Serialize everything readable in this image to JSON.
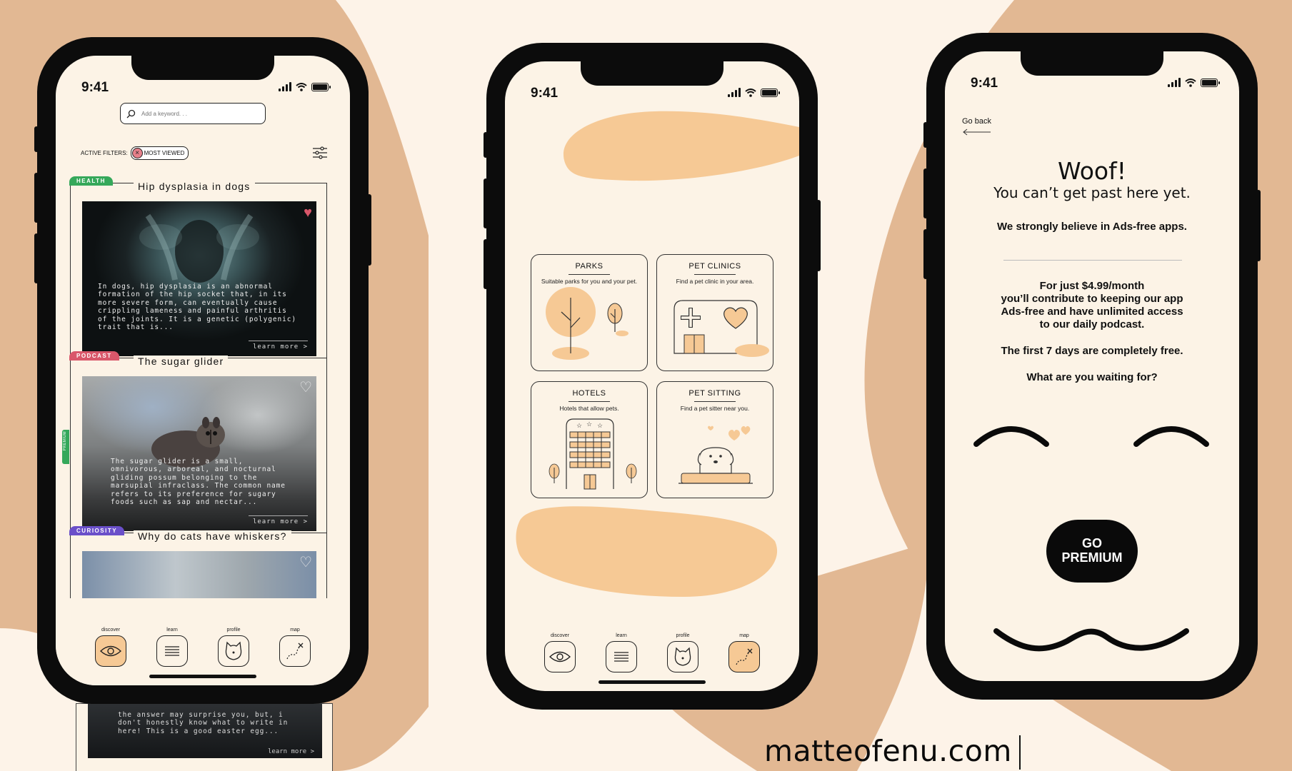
{
  "status_time": "9:41",
  "colors": {
    "background": "#fdf3e8",
    "accent_peach": "#f6c995",
    "tan_background": "#e2b893",
    "tag_health": "#35a85a",
    "tag_podcast": "#d9576a",
    "tag_curiosity": "#6a4fc9",
    "tag_premium": "#35a85a"
  },
  "discover": {
    "search_placeholder": "Add a keyword. . .",
    "active_filters_label": "ACTIVE FILTERS:",
    "filter_chip": "MOST VIEWED",
    "cards": [
      {
        "tag": "HEALTH",
        "title": "Hip dysplasia in dogs",
        "text": "In dogs, hip dysplasia is an abnormal formation of the hip socket that, in its more severe form, can eventually cause crippling lameness and painful arthritis of the joints. It is a genetic (polygenic) trait that is...",
        "learn_more": "learn more >",
        "favorited": true
      },
      {
        "tag": "PODCAST",
        "side_tag": "PREMIUM",
        "title": "The sugar glider",
        "text": "The sugar glider is a small, omnivorous, arboreal, and nocturnal gliding possum belonging to the marsupial infraclass. The common name refers to its preference for sugary foods such as sap and nectar...",
        "learn_more": "learn more >",
        "favorited": false
      },
      {
        "tag": "CURIOSITY",
        "title": "Why do cats have whiskers?",
        "text": "the answer may surprise you, but, i don't honestly know what to write in here! This is a good easter egg...",
        "learn_more": "learn more >",
        "favorited": false
      }
    ]
  },
  "nav": {
    "discover": "discover",
    "learn": "learn",
    "profile": "profile",
    "map": "map"
  },
  "map_screen": {
    "cards": [
      {
        "title": "PARKS",
        "desc": "Suitable parks for you and your pet."
      },
      {
        "title": "PET CLINICS",
        "desc": "Find a pet clinic in your area."
      },
      {
        "title": "HOTELS",
        "desc": "Hotels that allow pets."
      },
      {
        "title": "PET SITTING",
        "desc": "Find a pet sitter near you."
      }
    ]
  },
  "premium_screen": {
    "back": "Go back",
    "headline": "Woof!",
    "subheadline": "You can’t get past here yet.",
    "line1": "We strongly believe in Ads-free apps.",
    "offer_1": "For just $4.99/month",
    "offer_2": "you’ll contribute to keeping our app",
    "offer_3": "Ads-free and have unlimited access",
    "offer_4": "to our daily podcast.",
    "free_trial": "The first 7 days are completely free.",
    "question": "What are you waiting for?",
    "button_1": "GO",
    "button_2": "PREMIUM"
  },
  "brand": "matteofenu.com"
}
